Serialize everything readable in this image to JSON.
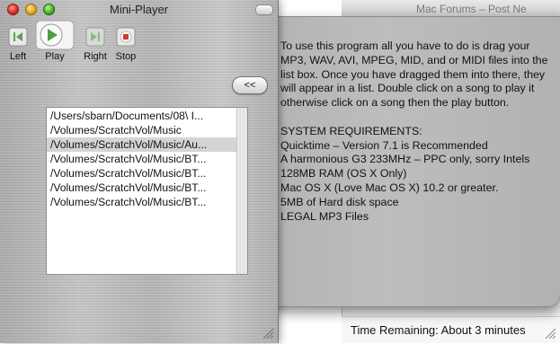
{
  "background_window": {
    "title": "Mac Forums – Post Ne",
    "status": "Time Remaining: About 3 minutes"
  },
  "window": {
    "title": "Mini-Player"
  },
  "controls": {
    "left_label": "Left",
    "play_label": "Play",
    "right_label": "Right",
    "stop_label": "Stop"
  },
  "collapse_label": "<<",
  "playlist": [
    "/Users/sbarn/Documents/08\\ I...",
    "/Volumes/ScratchVol/Music",
    "/Volumes/ScratchVol/Music/Au...",
    "/Volumes/ScratchVol/Music/BT...",
    "/Volumes/ScratchVol/Music/BT...",
    "/Volumes/ScratchVol/Music/BT...",
    "/Volumes/ScratchVol/Music/BT..."
  ],
  "selected_index": 2,
  "info": {
    "intro": "To use this program all you have to do is drag your MP3, WAV, AVI, MPEG, MID, and or MIDI files into the list box. Once you have dragged them into there, they will appear in a list. Double click on a song to play it otherwise click on a song then the play button.",
    "req_heading": "SYSTEM REQUIREMENTS:",
    "req_1": "Quicktime – Version 7.1 is Recommended",
    "req_2": "A harmonious G3 233MHz – PPC only, sorry Intels",
    "req_3": "128MB RAM (OS X Only)",
    "req_4": "Mac OS X (Love Mac OS X) 10.2 or greater.",
    "req_5": "5MB of Hard disk space",
    "req_6": "LEGAL MP3 Files"
  }
}
